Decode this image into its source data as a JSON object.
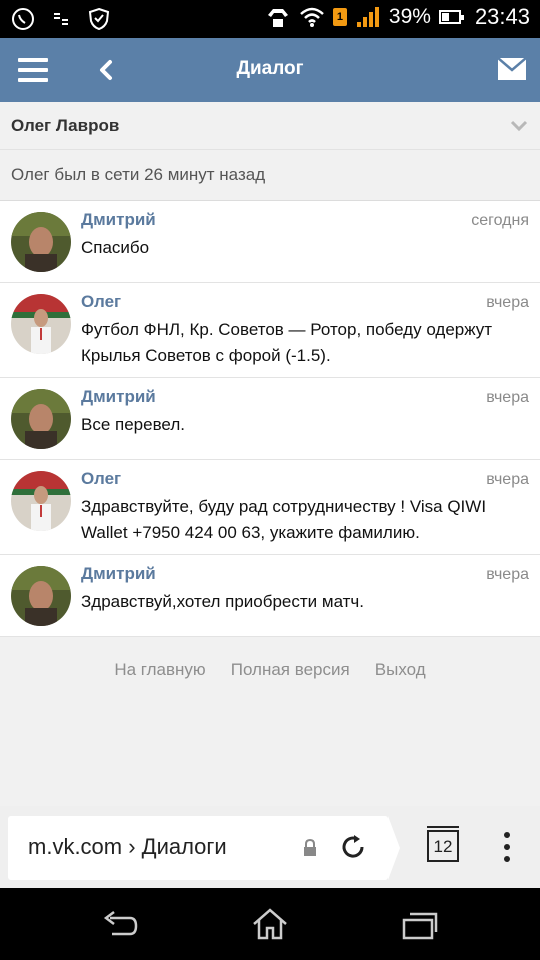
{
  "status_bar": {
    "battery_percent": "39%",
    "battery_level": 0.39,
    "time": "23:43",
    "sim_badge": "1",
    "icons": [
      "viber-icon",
      "data-icon",
      "shield-icon",
      "headset-icon",
      "wifi-icon",
      "signal-icon",
      "battery-icon"
    ]
  },
  "header": {
    "title": "Диалог",
    "icons": [
      "menu-icon",
      "back-arrow-icon",
      "mail-icon"
    ],
    "color": "#5b80a8"
  },
  "peer": {
    "name": "Олег Лавров",
    "status": "Олег был в сети 26 минут назад"
  },
  "messages": [
    {
      "author": "Дмитрий",
      "date": "сегодня",
      "text": "Спасибо",
      "avatar": "dmitry"
    },
    {
      "author": "Олег",
      "date": "вчера",
      "text": "Футбол ФНЛ, Кр. Советов — Ротор, победу одержут Крылья Советов с форой (-1.5).",
      "avatar": "oleg"
    },
    {
      "author": "Дмитрий",
      "date": "вчера",
      "text": "Все перевел.",
      "avatar": "dmitry"
    },
    {
      "author": "Олег",
      "date": "вчера",
      "text": "Здравствуйте, буду рад сотрудничеству ! Visa QIWI Wallet +7950 424 00 63, укажите фамилию.",
      "avatar": "oleg"
    },
    {
      "author": "Дмитрий",
      "date": "вчера",
      "text": "Здравствуй,хотел приобрести матч.",
      "avatar": "dmitry"
    }
  ],
  "footer": {
    "links": [
      "На главную",
      "Полная версия",
      "Выход"
    ]
  },
  "browser": {
    "url": "m.vk.com › Диалоги",
    "tab_count": "12"
  },
  "colors": {
    "accent": "#5b80a8",
    "author": "#5b7a9e"
  }
}
